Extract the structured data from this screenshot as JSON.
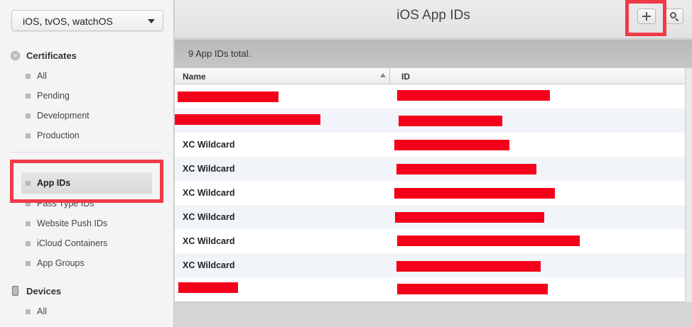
{
  "sidebar": {
    "platform_select": "iOS, tvOS, watchOS",
    "certificates": {
      "title": "Certificates",
      "icon": "certificate-icon",
      "items": [
        "All",
        "Pending",
        "Development",
        "Production"
      ]
    },
    "identifiers": {
      "items": [
        "App IDs",
        "Pass Type IDs",
        "Website Push IDs",
        "iCloud Containers",
        "App Groups"
      ],
      "active": "App IDs"
    },
    "devices": {
      "title": "Devices",
      "icon": "device-icon",
      "items": [
        "All"
      ]
    }
  },
  "header": {
    "title": "iOS App IDs",
    "add_icon": "plus-icon",
    "search_icon": "search-icon"
  },
  "summary": {
    "count_text": "9  App IDs total."
  },
  "table": {
    "columns": [
      "Name",
      "ID"
    ],
    "rows": [
      {
        "name": "",
        "name_redacted": true
      },
      {
        "name": "",
        "name_redacted": true
      },
      {
        "name": "XC Wildcard",
        "name_redacted": false
      },
      {
        "name": "XC Wildcard",
        "name_redacted": false
      },
      {
        "name": "XC Wildcard",
        "name_redacted": false
      },
      {
        "name": "XC Wildcard",
        "name_redacted": false
      },
      {
        "name": "XC Wildcard",
        "name_redacted": false
      },
      {
        "name": "XC Wildcard",
        "name_redacted": false
      },
      {
        "name": "",
        "name_redacted": true
      }
    ]
  },
  "colors": {
    "highlight": "#f03a47",
    "redaction": "#f5001a"
  }
}
